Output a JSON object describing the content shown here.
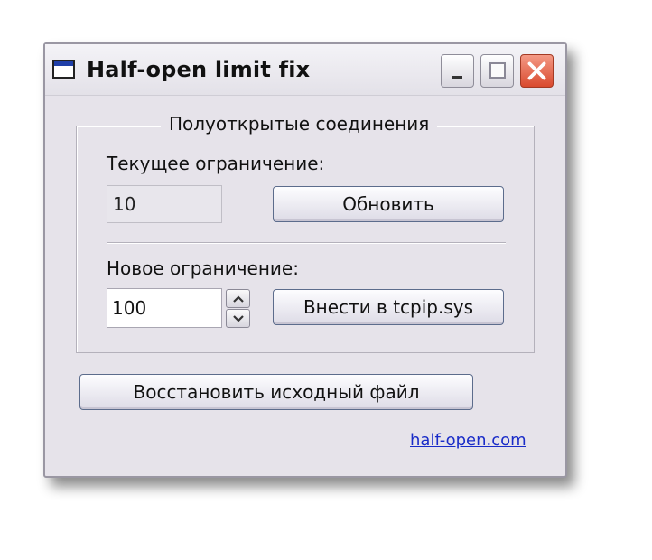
{
  "window": {
    "title": "Half-open limit fix"
  },
  "group": {
    "legend": "Полуоткрытые соединения",
    "current_label": "Текущее ограничение:",
    "current_value": "10",
    "update_label": "Обновить",
    "new_label": "Новое ограничение:",
    "new_value": "100",
    "apply_label": "Внести в tcpip.sys"
  },
  "restore_label": "Восстановить исходный файл",
  "link_text": "half-open.com",
  "icons": {
    "app": "app-window-icon",
    "minimize": "minimize-icon",
    "maximize": "maximize-icon",
    "close": "close-icon",
    "spin_up": "arrow-up-icon",
    "spin_down": "arrow-down-icon"
  },
  "colors": {
    "close_button": "#d94a2e",
    "link": "#1a2cc8",
    "window_bg": "#e6e3ea"
  }
}
